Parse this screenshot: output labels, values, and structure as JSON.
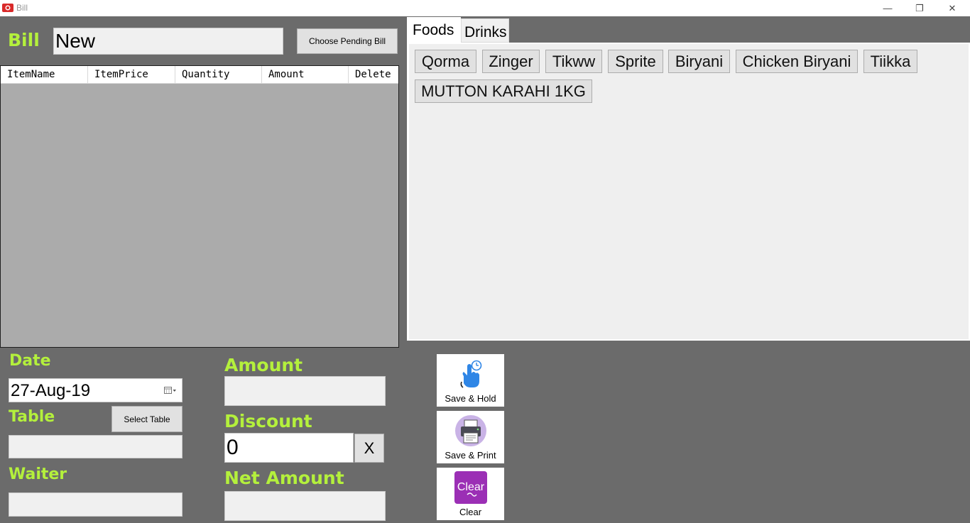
{
  "window": {
    "title": "Bill",
    "controls": {
      "minimize": "—",
      "maximize": "❐",
      "close": "✕"
    }
  },
  "bill": {
    "label": "Bill",
    "value": "New",
    "pending_button": "Choose Pending Bill"
  },
  "grid": {
    "columns": [
      "ItemName",
      "ItemPrice",
      "Quantity",
      "Amount",
      "Delete"
    ],
    "rows": []
  },
  "tabs": [
    {
      "label": "Foods",
      "selected": true
    },
    {
      "label": "Drinks",
      "selected": false
    }
  ],
  "foods": [
    "Qorma",
    "Zinger",
    "Tikww",
    "Sprite",
    "Biryani",
    "Chicken Biryani",
    "Tiikka",
    "MUTTON KARAHI 1KG"
  ],
  "form": {
    "date_label": "Date",
    "date_value": "27-Aug-19",
    "table_label": "Table",
    "select_table_button": "Select Table",
    "table_value": "",
    "waiter_label": "Waiter",
    "waiter_value": ""
  },
  "totals": {
    "amount_label": "Amount",
    "amount_value": "",
    "discount_label": "Discount",
    "discount_value": "0",
    "discount_clear": "X",
    "net_label": "Net Amount",
    "net_value": ""
  },
  "actions": {
    "save_hold": "Save & Hold",
    "save_print": "Save & Print",
    "clear": "Clear",
    "clear_icon_text": "Clear"
  },
  "colors": {
    "background": "#6b6b6b",
    "label_green": "#b4f03c",
    "grid_body": "#ababab",
    "clear_purple": "#9b2fb5",
    "hold_blue": "#2f86e6"
  },
  "icons": [
    "app-icon",
    "hand-clock-icon",
    "printer-icon",
    "clear-icon",
    "calendar-icon"
  ]
}
